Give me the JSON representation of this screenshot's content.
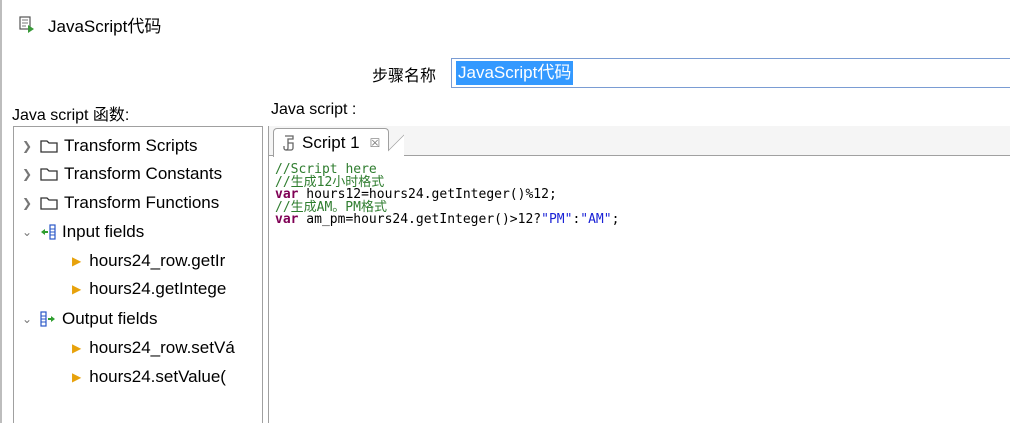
{
  "window": {
    "title": "JavaScript代码",
    "icon": "javascript-step-icon"
  },
  "step": {
    "label": "步骤名称",
    "value": "JavaScript代码"
  },
  "functions_label": "Java script 函数:",
  "script_label": "Java script :",
  "tree": {
    "transform_scripts": "Transform Scripts",
    "transform_constants": "Transform Constants",
    "transform_functions": "Transform Functions",
    "input_fields": "Input fields",
    "input_items": [
      "hours24_row.getIr",
      "hours24.getIntege"
    ],
    "output_fields": "Output fields",
    "output_items": [
      "hours24_row.setVá",
      "hours24.setValue("
    ]
  },
  "tab": {
    "label": "Script 1",
    "close": "☒"
  },
  "code": {
    "line1": "//Script here",
    "line2": "//生成12小时格式",
    "line3_kw": "var",
    "line3_rest": " hours12=hours24.getInteger()%12;",
    "line4": "//生成AM。PM格式",
    "line5_kw": "var",
    "line5_mid": " am_pm=hours24.getInteger()>12?",
    "line5_str1": "\"PM\"",
    "line5_colon": ":",
    "line5_str2": "\"AM\"",
    "line5_end": ";"
  },
  "colors": {
    "selection": "#3399ff",
    "comment": "#2f7d2f",
    "keyword": "#7f0055",
    "string": "#1a22d6",
    "folder_arrow": "#e7a20c"
  }
}
